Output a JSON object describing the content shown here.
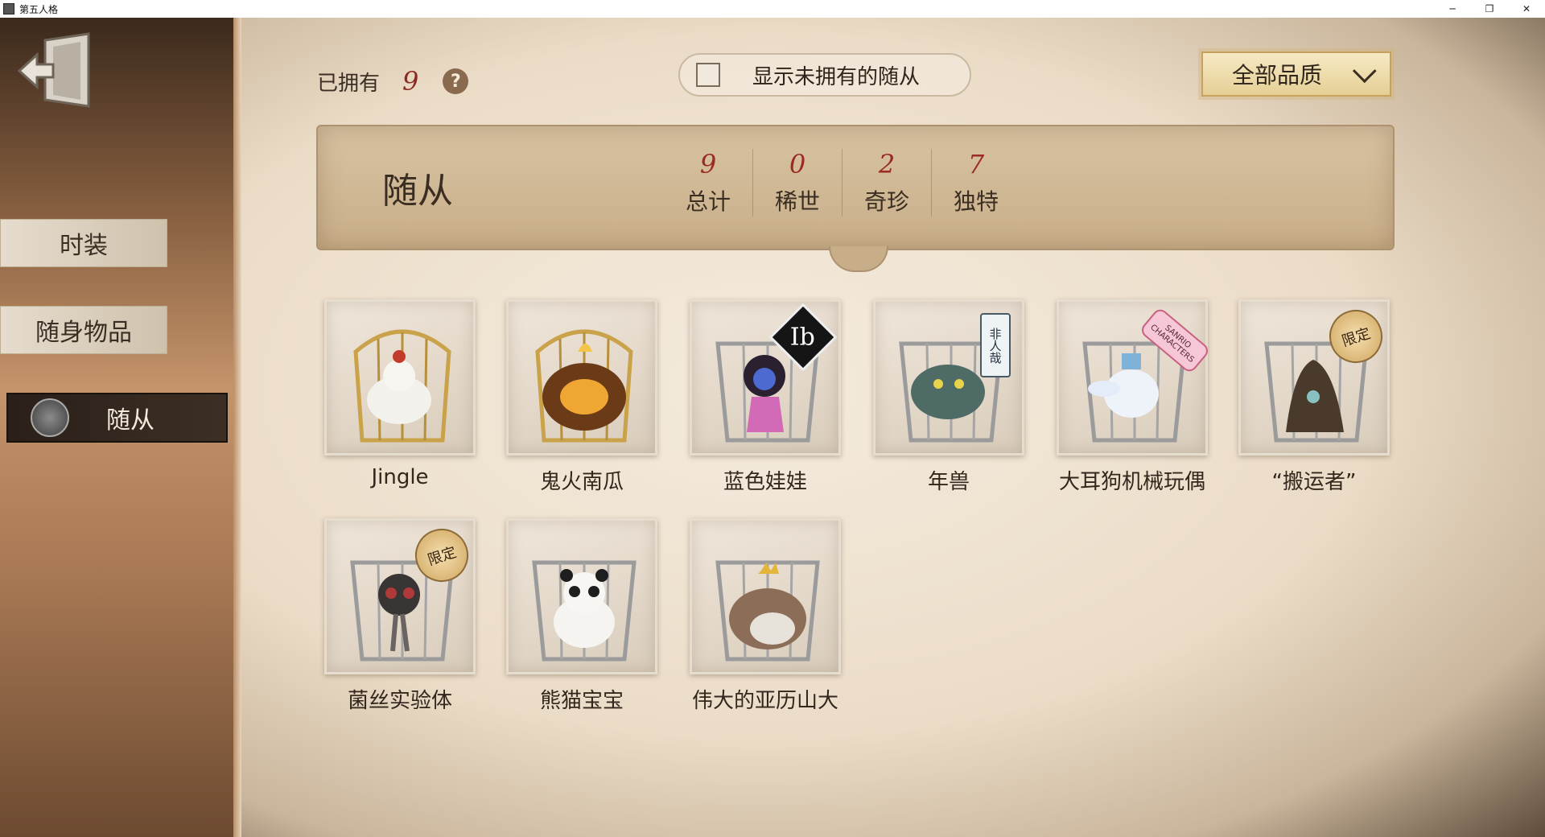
{
  "window": {
    "title": "第五人格",
    "controls": [
      "─",
      "❐",
      "✕"
    ]
  },
  "sidebar": {
    "tabs": [
      {
        "label": "时装"
      },
      {
        "label": "随身物品"
      },
      {
        "label": "随从",
        "active": true
      }
    ]
  },
  "header": {
    "owned_label": "已拥有",
    "owned_count": "9",
    "help_symbol": "?",
    "show_unowned_label": "显示未拥有的随从",
    "show_unowned_checked": false,
    "quality_filter": "全部品质"
  },
  "banner": {
    "title": "随从",
    "stats": [
      {
        "value": "9",
        "label": "总计"
      },
      {
        "value": "0",
        "label": "稀世"
      },
      {
        "value": "2",
        "label": "奇珍"
      },
      {
        "value": "7",
        "label": "独特"
      }
    ]
  },
  "pets": [
    {
      "name": "Jingle",
      "badge": ""
    },
    {
      "name": "鬼火南瓜",
      "badge": ""
    },
    {
      "name": "蓝色娃娃",
      "badge": "Ib"
    },
    {
      "name": "年兽",
      "badge": "非人哉"
    },
    {
      "name": "大耳狗机械玩偶",
      "badge": "SANRIO CHARACTERS"
    },
    {
      "name": "“搬运者”",
      "badge": "限定"
    },
    {
      "name": "菌丝实验体",
      "badge": "限定"
    },
    {
      "name": "熊猫宝宝",
      "badge": ""
    },
    {
      "name": "伟大的亚历山大",
      "badge": ""
    }
  ],
  "colors": {
    "accent_red": "#9b2b22",
    "active_tab_bg": "#2a2019",
    "quality_gold": "#e5cf95"
  }
}
